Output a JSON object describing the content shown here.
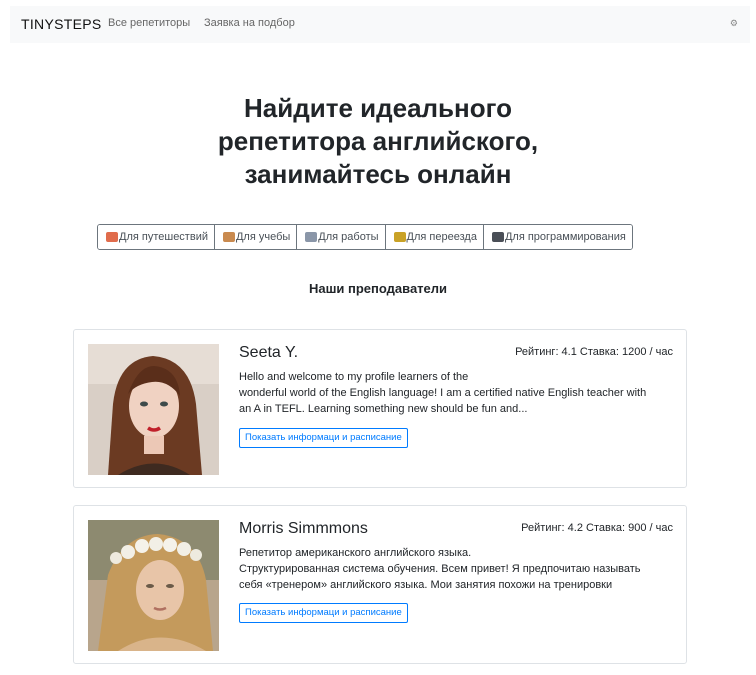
{
  "navbar": {
    "brand": "TINYSTEPS",
    "links": [
      "Все репетиторы",
      "Заявка на подбор"
    ],
    "settings_icon": "gear-icon"
  },
  "hero": {
    "lines": [
      "Найдите идеального",
      "репетитора английского,",
      "занимайтесь онлайн"
    ]
  },
  "categories": [
    {
      "label": "Для путешествий",
      "icon": "travel-icon",
      "color": "#e06c4c"
    },
    {
      "label": "Для учебы",
      "icon": "school-icon",
      "color": "#c98a4f"
    },
    {
      "label": "Для работы",
      "icon": "office-icon",
      "color": "#8a96a8"
    },
    {
      "label": "Для переезда",
      "icon": "tractor-icon",
      "color": "#c9a227"
    },
    {
      "label": "Для программирования",
      "icon": "laptop-icon",
      "color": "#4a4f57"
    }
  ],
  "section_title": "Наши преподаватели",
  "teachers": [
    {
      "name": "Seeta Y.",
      "meta": "Рейтинг: 4.1 Ставка: 1200 / час",
      "description": [
        "Hello and welcome to my profile learners of the",
        "wonderful world of the English language! I am a certified native English teacher with",
        "an A in TEFL. Learning something new should be fun and..."
      ],
      "button": "Показать информаци и расписание"
    },
    {
      "name": "Morris Simmmons",
      "meta": "Рейтинг: 4.2 Ставка: 900 / час",
      "description": [
        "Репетитор американского английского языка.",
        "Структурированная система обучения. Всем привет! Я предпочитаю называть",
        "себя «тренером» английского языка. Мои занятия похожи на тренировки"
      ],
      "button": "Показать информаци и расписание"
    }
  ]
}
